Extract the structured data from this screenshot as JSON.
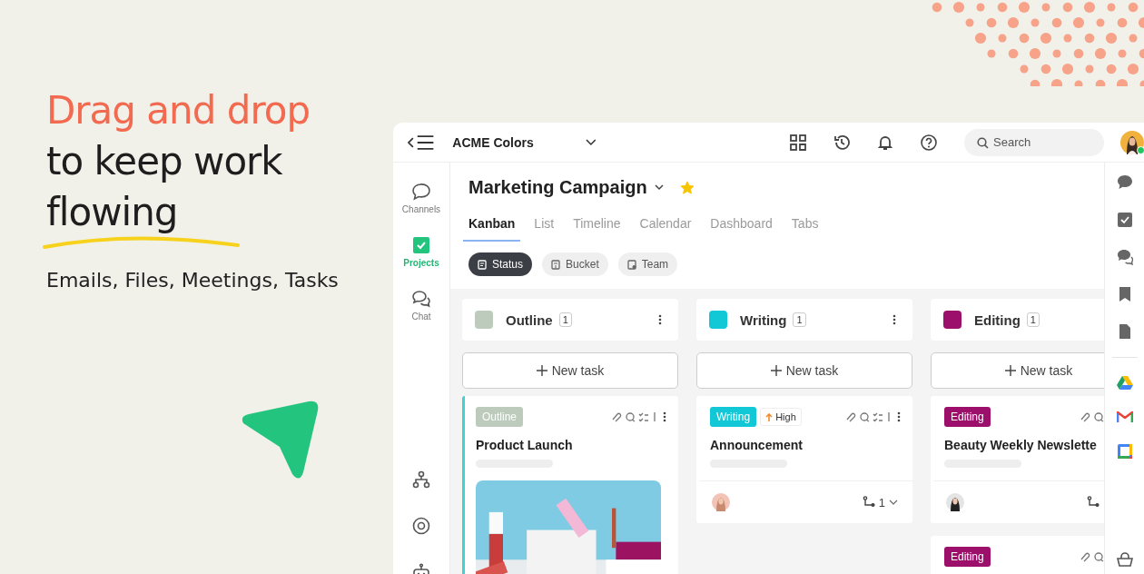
{
  "headline": {
    "accent": "Drag and drop",
    "lines": [
      "to keep work",
      "flowing"
    ]
  },
  "subtitle": "Emails, Files, Meetings, Tasks",
  "app": {
    "workspace": "ACME Colors",
    "search": {
      "placeholder": "Search"
    },
    "nav": [
      {
        "label": "Channels",
        "kind": "channels",
        "selected": false
      },
      {
        "label": "Projects",
        "kind": "projects",
        "selected": true
      },
      {
        "label": "Chat",
        "kind": "chat",
        "selected": false
      }
    ],
    "project": {
      "title": "Marketing Campaign",
      "starred": true
    },
    "tabs": [
      {
        "label": "Kanban",
        "selected": true
      },
      {
        "label": "List",
        "selected": false
      },
      {
        "label": "Timeline",
        "selected": false
      },
      {
        "label": "Calendar",
        "selected": false
      },
      {
        "label": "Dashboard",
        "selected": false
      },
      {
        "label": "Tabs",
        "selected": false
      }
    ],
    "groupings": [
      {
        "label": "Status",
        "kind": "status",
        "selected": true
      },
      {
        "label": "Bucket",
        "kind": "bucket",
        "selected": false
      },
      {
        "label": "Team",
        "kind": "team",
        "selected": false
      }
    ],
    "columns": [
      {
        "name": "Outline",
        "color": "#bccbbc",
        "count": "1",
        "action": "New task",
        "cards": [
          {
            "tag": "Outline",
            "title": "Product Launch",
            "accent": true
          }
        ]
      },
      {
        "name": "Writing",
        "color": "#12c8d6",
        "count": "1",
        "action": "New task",
        "cards": [
          {
            "tag": "Writing",
            "priority": "High",
            "title": "Announcement",
            "accent": false,
            "footer": {
              "avatar": true,
              "subtasks": "1"
            }
          }
        ]
      },
      {
        "name": "Editing",
        "color": "#9c0f6a",
        "count": "1",
        "action": "New task",
        "cards": [
          {
            "tag": "Editing",
            "title": "Beauty Weekly Newslette",
            "accent": false,
            "footer": {
              "avatar": true
            }
          },
          {
            "tag": "Editing",
            "accent": false
          }
        ]
      }
    ]
  }
}
